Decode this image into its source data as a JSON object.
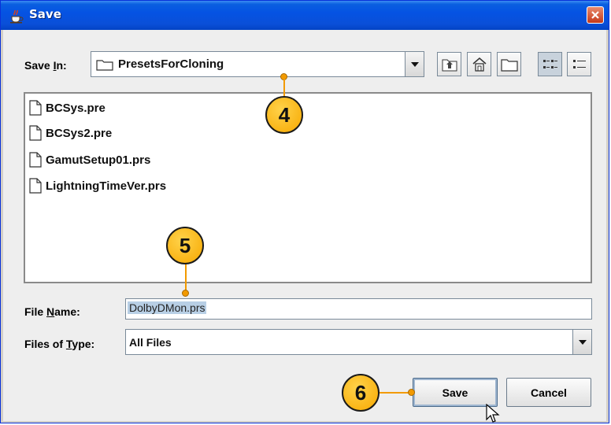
{
  "window": {
    "title": "Save"
  },
  "save_in": {
    "label_pre": "Save ",
    "label_key": "I",
    "label_post": "n:",
    "value": "PresetsForCloning"
  },
  "toolbar": {
    "buttons": [
      {
        "icon": "up-folder-icon"
      },
      {
        "icon": "home-icon"
      },
      {
        "icon": "new-folder-icon"
      },
      {
        "icon": "list-view-icon"
      },
      {
        "icon": "details-view-icon"
      }
    ]
  },
  "files": [
    {
      "name": "BCSys.pre"
    },
    {
      "name": "BCSys2.pre"
    },
    {
      "name": "GamutSetup01.prs"
    },
    {
      "name": "LightningTimeVer.prs"
    }
  ],
  "file_name": {
    "label_pre": "File ",
    "label_key": "N",
    "label_post": "ame:",
    "value": "DolbyDMon.prs"
  },
  "file_type": {
    "label_pre": "Files of ",
    "label_key": "T",
    "label_post": "ype:",
    "value": "All Files"
  },
  "buttons": {
    "save": "Save",
    "cancel": "Cancel"
  },
  "callouts": {
    "c4": "4",
    "c5": "5",
    "c6": "6"
  },
  "colors": {
    "titlebar": "#0553e3",
    "callout": "#f7a800",
    "selection": "#b8cfe5"
  }
}
